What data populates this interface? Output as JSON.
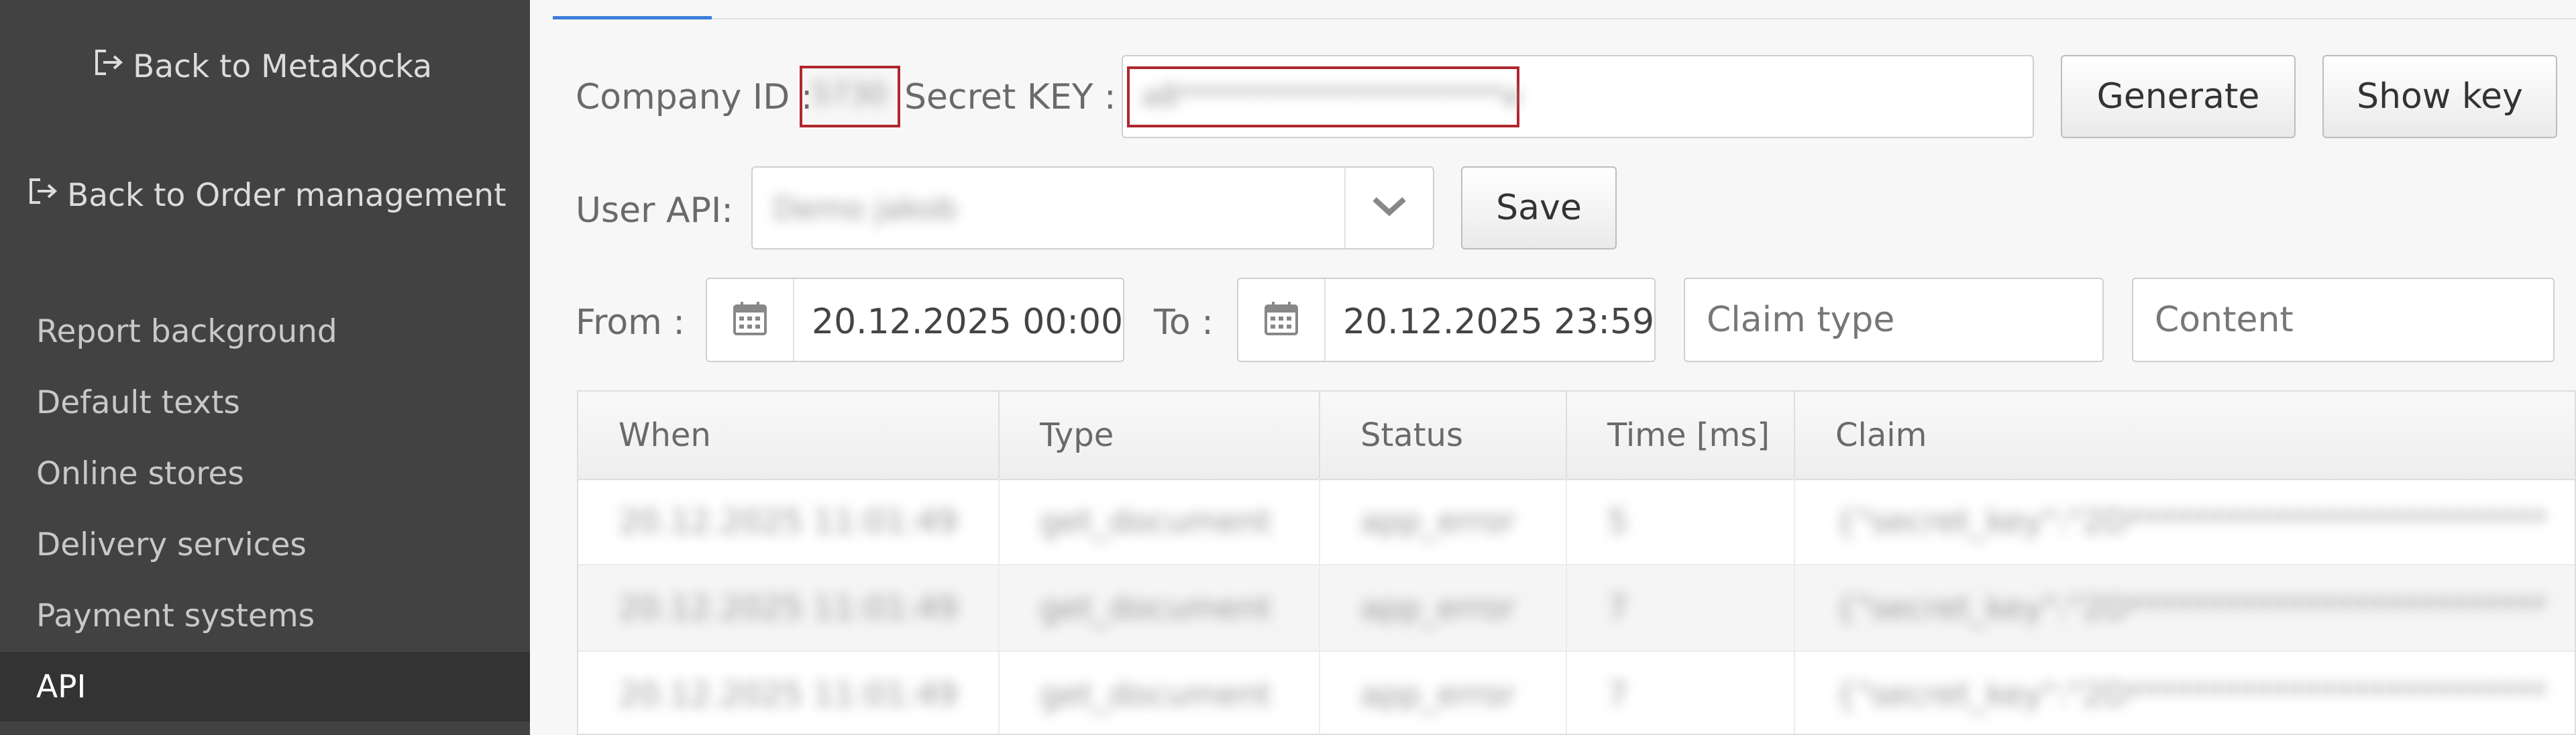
{
  "sidebar": {
    "back_metakocka": "Back to MetaKocka",
    "back_order_management": "Back to Order management",
    "items": [
      {
        "label": "Report background"
      },
      {
        "label": "Default texts"
      },
      {
        "label": "Online stores"
      },
      {
        "label": "Delivery services"
      },
      {
        "label": "Payment systems"
      },
      {
        "label": "API"
      }
    ]
  },
  "api": {
    "company_id_label": "Company ID :",
    "company_id_value": "5730",
    "secret_key_label": "Secret KEY :",
    "secret_key_value": "a8**********************e",
    "generate_label": "Generate",
    "show_key_label": "Show key",
    "user_api_label": "User API:",
    "user_api_value": "Demo jakob",
    "save_label": "Save"
  },
  "filters": {
    "from_label": "From :",
    "from_value": "20.12.2025 00:00",
    "to_label": "To :",
    "to_value": "20.12.2025 23:59",
    "claim_type_placeholder": "Claim type",
    "content_placeholder": "Content"
  },
  "table": {
    "columns": [
      "When",
      "Type",
      "Status",
      "Time [ms]",
      "Claim"
    ],
    "rows": [
      [
        "20.12.2025 11:01:49",
        "get_document",
        "app_error",
        "5",
        "{\"secret_key\":\"2D**************************"
      ],
      [
        "20.12.2025 11:01:49",
        "get_document",
        "app_error",
        "7",
        "{\"secret_key\":\"2D**************************"
      ],
      [
        "20.12.2025 11:01:49",
        "get_document",
        "app_error",
        "7",
        "{\"secret_key\":\"2D**************************"
      ]
    ]
  },
  "colors": {
    "sidebar_bg": "#424242",
    "active_bg": "#333333",
    "accent": "#3d7ed8",
    "highlight": "#b0272e"
  }
}
